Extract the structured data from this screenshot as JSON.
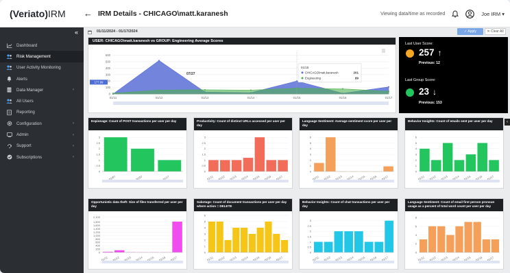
{
  "header": {
    "logo_brand": "(Veriato)",
    "logo_product": "IRM",
    "back_glyph": "←",
    "title": "IRM Details  - CHICAGO\\matt.karanesh",
    "viewing_note": "Viewing data/time as recorded",
    "user_name": "Joe IRM ▾"
  },
  "sidebar": {
    "collapse_glyph": "«",
    "items": [
      {
        "label": "Dashboard",
        "icon": "chart-line-icon",
        "active": false,
        "arrow": ""
      },
      {
        "label": "Risk Management",
        "icon": "users-icon",
        "active": true,
        "arrow": ""
      },
      {
        "label": "User Activity Monitoring",
        "icon": "users-icon",
        "active": false,
        "arrow": ""
      },
      {
        "label": "Alerts",
        "icon": "bell-icon",
        "active": false,
        "arrow": ""
      },
      {
        "label": "Data Manager",
        "icon": "database-icon",
        "active": false,
        "arrow": "›"
      },
      {
        "label": "All Users",
        "icon": "users-icon",
        "active": false,
        "arrow": ""
      },
      {
        "label": "Reporting",
        "icon": "report-icon",
        "active": false,
        "arrow": ""
      },
      {
        "label": "Configuration",
        "icon": "gear-icon",
        "active": false,
        "arrow": "›"
      },
      {
        "label": "Admin",
        "icon": "admin-icon",
        "active": false,
        "arrow": "›"
      },
      {
        "label": "Support",
        "icon": "support-icon",
        "active": false,
        "arrow": "›"
      },
      {
        "label": "Subscriptions",
        "icon": "check-circle-icon",
        "active": false,
        "arrow": "›"
      }
    ]
  },
  "filter": {
    "date_range": "01/11/2024 - 01/17/2024",
    "apply_label": "✓ Apply",
    "clear_label": "✕ Clear All"
  },
  "main_chart": {
    "title": "USER: CHICAGO\\matt.karanesh vs GROUP: Engineering Average Scores",
    "peak_label": "07/27",
    "tooltip": {
      "date": "01/15",
      "user_label": "CHICAGO\\matt.karanesh",
      "user_value": "201",
      "group_label": "Engineering",
      "group_value": "89"
    },
    "y_marker": "177.99"
  },
  "scores": {
    "user_label": "Last User Score:",
    "user_value": "257",
    "user_arrow": "↑",
    "user_prev": "Previous: 12",
    "group_label": "Last Group Score:",
    "group_value": "23",
    "group_arrow": "↓",
    "group_prev": "Previous: 153",
    "user_color": "#f5a623",
    "group_color": "#22c55e"
  },
  "chart_data": [
    {
      "type": "area",
      "title": "USER: CHICAGO\\matt.karanesh vs GROUP: Engineering Average Scores",
      "categories": [
        "01/11",
        "01/12",
        "01/13",
        "01/14",
        "01/15",
        "01/16",
        "01/17"
      ],
      "yticks": [
        "600",
        "500",
        "400",
        "300",
        "200",
        "100",
        "0"
      ],
      "ylim": [
        0,
        650
      ],
      "series": [
        {
          "name": "CHICAGO\\matt.karanesh",
          "color": "#5b6fd6",
          "values": [
            0,
            520,
            30,
            20,
            201,
            10,
            110
          ]
        },
        {
          "name": "Engineering",
          "color": "#4caf50",
          "values": [
            10,
            60,
            65,
            60,
            89,
            80,
            40
          ]
        }
      ]
    },
    {
      "type": "bar",
      "title": "Espionage: Count of POST transactions per user per day",
      "color": "#22c55e",
      "categories": [
        "01/07",
        "01/07",
        "01/17"
      ],
      "values": [
        3,
        2,
        1
      ],
      "yticks": [
        "3",
        "2.5",
        "2",
        "1.5",
        "1",
        "0.5",
        "0"
      ],
      "ylim": [
        0,
        3.25
      ]
    },
    {
      "type": "bar",
      "title": "Productivity: Count of distinct URLs accessed per user per day",
      "color": "#f26c5a",
      "categories": [
        "01/11",
        "01/12",
        "01/13",
        "01/14",
        "01/15",
        "01/16",
        "01/17"
      ],
      "values": [
        1,
        1,
        1,
        1.2,
        3,
        1,
        1
      ],
      "yticks": [
        "3",
        "2.5",
        "2",
        "1.5",
        "1",
        "0.5",
        "0"
      ],
      "ylim": [
        0,
        3.25
      ]
    },
    {
      "type": "bar",
      "title": "Language Sentiment: Average sentiment score per user per day",
      "color": "#f5a05a",
      "categories": [
        "01/11",
        "01/12",
        "01/13",
        "01/14",
        "01/15",
        "01/16",
        "01/17"
      ],
      "values": [
        1.5,
        6,
        0,
        0,
        0,
        0,
        0.9
      ],
      "yticks": [
        "6",
        "5",
        "4",
        "3",
        "2",
        "1",
        "0"
      ],
      "ylim": [
        0,
        6.5
      ]
    },
    {
      "type": "bar",
      "title": "Behavior Insights: Count of emails sent per user per day",
      "color": "#22c55e",
      "categories": [
        "01/11",
        "01/12",
        "01/13",
        "01/14",
        "01/15",
        "01/16",
        "01/17"
      ],
      "values": [
        4,
        2,
        5,
        2,
        3,
        5,
        2
      ],
      "yticks": [
        "6",
        "5",
        "4",
        "3",
        "2",
        "1",
        "0"
      ],
      "ylim": [
        0,
        6.5
      ]
    },
    {
      "type": "bar",
      "title": "Opportunistic data theft: Size of files transferred per user per day",
      "color": "#f04cf0",
      "categories": [
        "01/11",
        "01/12",
        "01/13",
        "01/14",
        "01/15",
        "01/16",
        "01/17"
      ],
      "values": [
        40,
        130,
        15,
        10,
        10,
        10,
        1830
      ],
      "yticks": [
        "2,100",
        "1,800",
        "1,600",
        "1,400",
        "1,200",
        "1,000",
        "800",
        "600",
        "400",
        "200",
        "0"
      ],
      "ylim": [
        0,
        2200
      ]
    },
    {
      "type": "bar",
      "title": "Sabotage: Count of document transactions per user per day where action = DELETE",
      "color": "#f5c518",
      "categories": [
        "01/11",
        "01/12",
        "01/13",
        "01/14",
        "01/15",
        "01/16",
        "01/17"
      ],
      "values": [
        5,
        5,
        2,
        4,
        4,
        3,
        4,
        5,
        3,
        2
      ],
      "yticks": [
        "6",
        "5",
        "4",
        "3",
        "2",
        "1",
        "0"
      ],
      "ylim": [
        0,
        6
      ]
    },
    {
      "type": "bar",
      "title": "Behavior Insights: Count of chat transactions per user per day",
      "color": "#22c7e8",
      "categories": [
        "01/11",
        "01/12",
        "01/13",
        "01/14",
        "01/15",
        "01/16",
        "01/17"
      ],
      "values": [
        1,
        1,
        2,
        2,
        2,
        1,
        1,
        3
      ],
      "yticks": [
        "3",
        "2.5",
        "2",
        "1.5",
        "1",
        "0.5",
        "0"
      ],
      "ylim": [
        0,
        3.5
      ]
    },
    {
      "type": "bar",
      "title": "Language Sentiment: Count of email first person pronoun usage as a percent of total word count per user per day",
      "color": "#f5a05a",
      "categories": [
        "01/11",
        "01/12",
        "01/13",
        "01/14",
        "01/15",
        "01/16",
        "01/17"
      ],
      "values": [
        3,
        6,
        6,
        4,
        6,
        7,
        7,
        3,
        3
      ],
      "yticks": [
        "8",
        "6",
        "4",
        "2",
        "0"
      ],
      "ylim": [
        0,
        8.5
      ]
    }
  ]
}
